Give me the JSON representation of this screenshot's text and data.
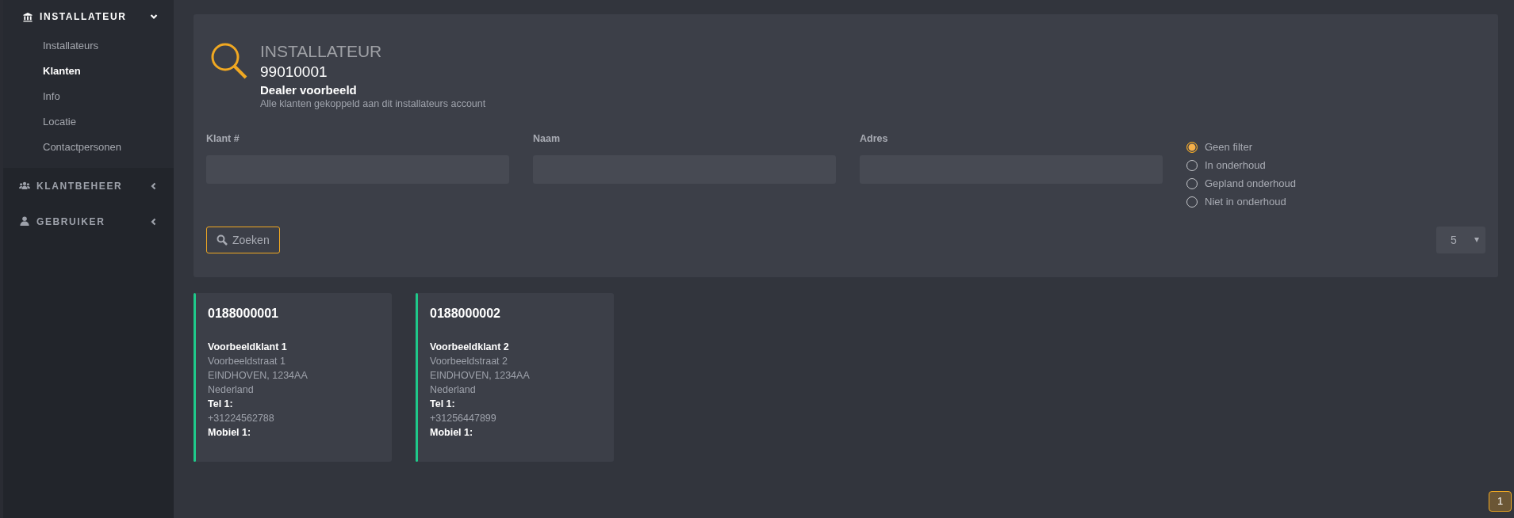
{
  "sidebar": {
    "sections": [
      {
        "label": "INSTALLATEUR",
        "kind": "bank",
        "expanded": true,
        "items": [
          {
            "label": "Installateurs",
            "selected": false
          },
          {
            "label": "Klanten",
            "selected": true
          },
          {
            "label": "Info",
            "selected": false
          },
          {
            "label": "Locatie",
            "selected": false
          },
          {
            "label": "Contactpersonen",
            "selected": false
          }
        ]
      },
      {
        "label": "KLANTBEHEER",
        "kind": "users",
        "expanded": false
      },
      {
        "label": "GEBRUIKER",
        "kind": "user",
        "expanded": false
      }
    ]
  },
  "header": {
    "title": "INSTALLATEUR",
    "number": "99010001",
    "name": "Dealer voorbeeld",
    "description": "Alle klanten gekoppeld aan dit installateurs account"
  },
  "filters": {
    "fields": [
      {
        "label": "Klant #"
      },
      {
        "label": "Naam"
      },
      {
        "label": "Adres"
      }
    ],
    "options": [
      {
        "label": "Geen filter",
        "selected": true
      },
      {
        "label": "In onderhoud",
        "selected": false
      },
      {
        "label": "Gepland onderhoud",
        "selected": false
      },
      {
        "label": "Niet in onderhoud",
        "selected": false
      }
    ],
    "search_button": "Zoeken",
    "page_size": "5"
  },
  "customers": [
    {
      "number": "0188000001",
      "name": "Voorbeeldklant 1",
      "street": "Voorbeeldstraat 1",
      "city": "EINDHOVEN, 1234AA",
      "country": "Nederland",
      "tel_label": "Tel 1:",
      "tel": "+31224562788",
      "mobile_label": "Mobiel 1:",
      "color": "#1fc98a"
    },
    {
      "number": "0188000002",
      "name": "Voorbeeldklant 2",
      "street": "Voorbeeldstraat 2",
      "city": "EINDHOVEN, 1234AA",
      "country": "Nederland",
      "tel_label": "Tel 1:",
      "tel": "+31256447899",
      "mobile_label": "Mobiel 1:",
      "color": "#1fc98a"
    }
  ],
  "pagination": [
    {
      "label": "1",
      "selected": true
    }
  ]
}
